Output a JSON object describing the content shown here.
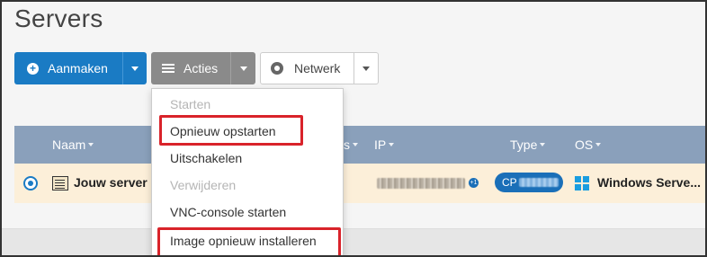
{
  "page": {
    "title": "Servers"
  },
  "toolbar": {
    "create_label": "Aanmaken",
    "actions_label": "Acties",
    "network_label": "Netwerk"
  },
  "table": {
    "columns": {
      "name": "Naam",
      "status_partial": "s",
      "ip": "IP",
      "type": "Type",
      "os": "OS"
    },
    "rows": [
      {
        "name": "Jouw server",
        "ip_extra": "+1",
        "type_prefix": "CP",
        "os": "Windows Serve..."
      }
    ]
  },
  "actions_menu": {
    "items": [
      {
        "label": "Starten",
        "disabled": true
      },
      {
        "label": "Opnieuw opstarten",
        "disabled": false,
        "highlighted": true
      },
      {
        "label": "Uitschakelen",
        "disabled": false
      },
      {
        "label": "Verwijderen",
        "disabled": true
      },
      {
        "label": "VNC-console starten",
        "disabled": false
      },
      {
        "label": "Image opnieuw installeren",
        "disabled": false,
        "highlighted": true
      }
    ]
  },
  "colors": {
    "primary": "#1a7bc4",
    "header": "#8aa0bb",
    "selected_row": "#fcefd9",
    "highlight": "#d9232a"
  }
}
